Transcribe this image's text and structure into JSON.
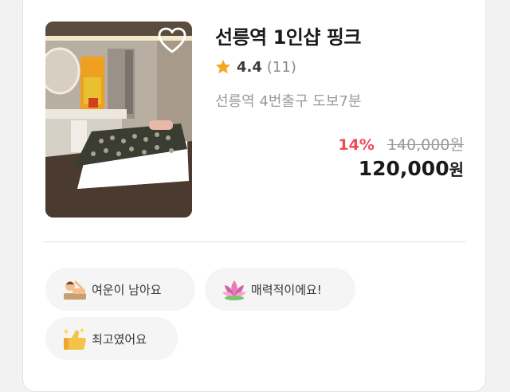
{
  "product": {
    "title": "선릉역 1인샵 핑크",
    "rating": "4.4",
    "review_count": "(11)",
    "location": "선릉역 4번출구 도보7분",
    "discount": "14%",
    "original_price": "140,000원",
    "price": "120,000",
    "price_unit": "원"
  },
  "chips": [
    {
      "label": "여운이 남아요",
      "icon": "massage-person-icon"
    },
    {
      "label": "매력적이에요!",
      "icon": "lotus-icon"
    },
    {
      "label": "최고였어요",
      "icon": "thumbs-up-sparkle-icon"
    }
  ],
  "colors": {
    "discount": "#ef4a5a",
    "star": "#f5a623",
    "chip_bg": "#f5f5f5"
  }
}
